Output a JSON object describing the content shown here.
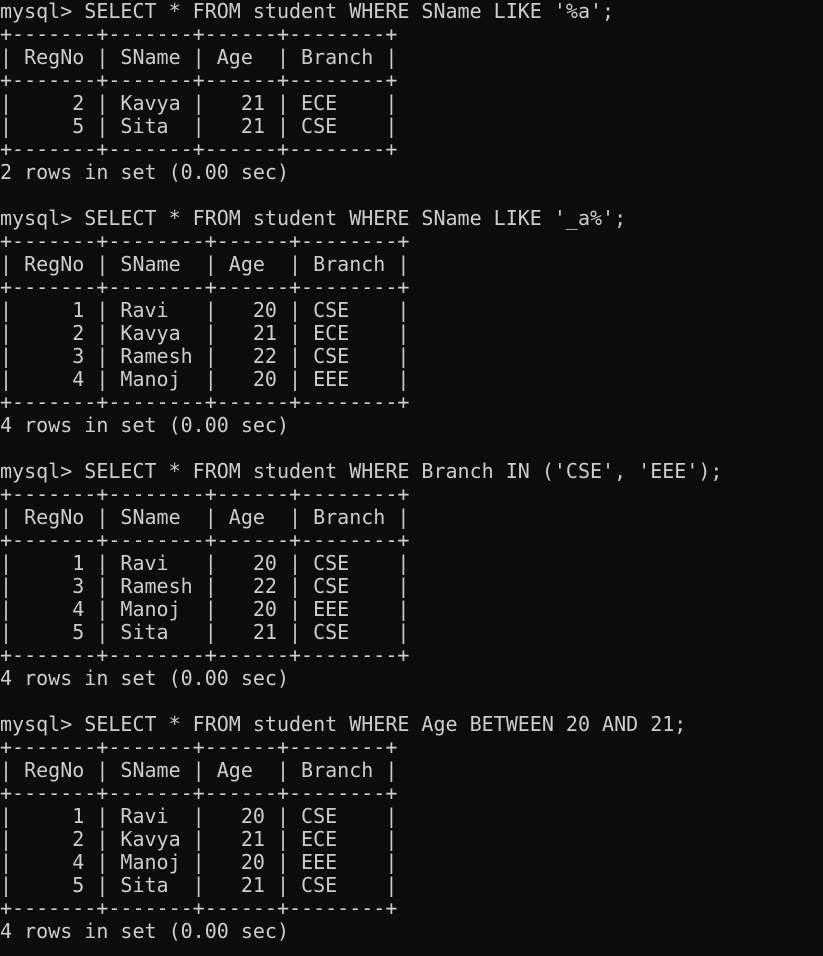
{
  "terminal": {
    "lines": [
      "mysql> SELECT * FROM student WHERE SName LIKE '%a';",
      "+-------+-------+------+--------+",
      "| RegNo | SName | Age  | Branch |",
      "+-------+-------+------+--------+",
      "|     2 | Kavya |   21 | ECE    |",
      "|     5 | Sita  |   21 | CSE    |",
      "+-------+-------+------+--------+",
      "2 rows in set (0.00 sec)",
      "",
      "mysql> SELECT * FROM student WHERE SName LIKE '_a%';",
      "+-------+--------+------+--------+",
      "| RegNo | SName  | Age  | Branch |",
      "+-------+--------+------+--------+",
      "|     1 | Ravi   |   20 | CSE    |",
      "|     2 | Kavya  |   21 | ECE    |",
      "|     3 | Ramesh |   22 | CSE    |",
      "|     4 | Manoj  |   20 | EEE    |",
      "+-------+--------+------+--------+",
      "4 rows in set (0.00 sec)",
      "",
      "mysql> SELECT * FROM student WHERE Branch IN ('CSE', 'EEE');",
      "+-------+--------+------+--------+",
      "| RegNo | SName  | Age  | Branch |",
      "+-------+--------+------+--------+",
      "|     1 | Ravi   |   20 | CSE    |",
      "|     3 | Ramesh |   22 | CSE    |",
      "|     4 | Manoj  |   20 | EEE    |",
      "|     5 | Sita   |   21 | CSE    |",
      "+-------+--------+------+--------+",
      "4 rows in set (0.00 sec)",
      "",
      "mysql> SELECT * FROM student WHERE Age BETWEEN 20 AND 21;",
      "+-------+-------+------+--------+",
      "| RegNo | SName | Age  | Branch |",
      "+-------+-------+------+--------+",
      "|     1 | Ravi  |   20 | CSE    |",
      "|     2 | Kavya |   21 | ECE    |",
      "|     4 | Manoj |   20 | EEE    |",
      "|     5 | Sita  |   21 | CSE    |",
      "+-------+-------+------+--------+",
      "4 rows in set (0.00 sec)"
    ]
  }
}
